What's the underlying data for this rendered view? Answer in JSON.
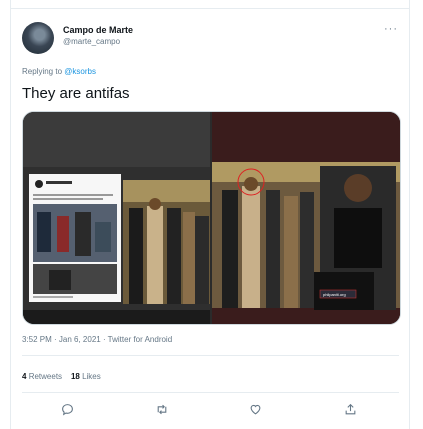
{
  "tweet": {
    "author_name": "Campo de Marte",
    "author_handle": "@marte_campo",
    "more_label": "···",
    "replying_prefix": "Replying to",
    "replying_to": "@ksorbs",
    "text": "They are antifas",
    "timestamp": "3:52 PM · Jan 6, 2021 · Twitter for Android",
    "retweets_count": "4",
    "retweets_label": "Retweets",
    "likes_count": "18",
    "likes_label": "Likes"
  },
  "media": {
    "inset_caption": "philpaniti.org"
  },
  "actions": [
    {
      "name": "reply-icon"
    },
    {
      "name": "retweet-icon"
    },
    {
      "name": "like-icon"
    },
    {
      "name": "share-icon"
    }
  ],
  "colors": {
    "link": "#1b95e0",
    "secondary_text": "#657786",
    "divider": "#e6ecf0"
  }
}
